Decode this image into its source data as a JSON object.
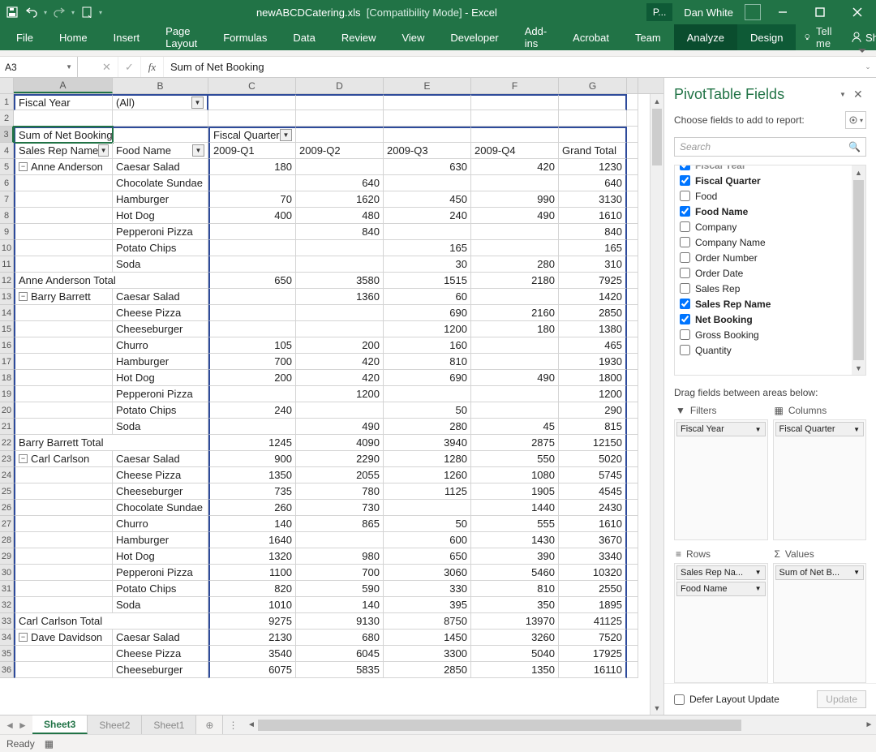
{
  "title": {
    "doc": "newABCDCatering.xls",
    "mode": "[Compatibility Mode]",
    "app": "Excel"
  },
  "account": {
    "context_letter": "P...",
    "user": "Dan White"
  },
  "ribbon": {
    "tabs": [
      "File",
      "Home",
      "Insert",
      "Page Layout",
      "Formulas",
      "Data",
      "Review",
      "View",
      "Developer",
      "Add-ins",
      "Acrobat",
      "Team",
      "Analyze",
      "Design"
    ],
    "tell_me": "Tell me",
    "share": "Share"
  },
  "namebox": "A3",
  "formula": "Sum of Net Booking",
  "columns": [
    "A",
    "B",
    "C",
    "D",
    "E",
    "F",
    "G"
  ],
  "pivot": {
    "page_field_label": "Fiscal Year",
    "page_field_value": "(All)",
    "data_field_label": "Sum of Net Booking",
    "col_field_label": "Fiscal Quarter",
    "row_field1_label": "Sales Rep Name",
    "row_field2_label": "Food Name",
    "col_headers": [
      "2009-Q1",
      "2009-Q2",
      "2009-Q3",
      "2009-Q4",
      "Grand Total"
    ]
  },
  "rows": [
    {
      "n": 5,
      "a": "Anne Anderson",
      "collapse": true,
      "b": "Caesar Salad",
      "c": "180",
      "d": "",
      "e": "630",
      "f": "420",
      "g": "1230"
    },
    {
      "n": 6,
      "a": "",
      "b": "Chocolate Sundae",
      "c": "",
      "d": "640",
      "e": "",
      "f": "",
      "g": "640"
    },
    {
      "n": 7,
      "a": "",
      "b": "Hamburger",
      "c": "70",
      "d": "1620",
      "e": "450",
      "f": "990",
      "g": "3130"
    },
    {
      "n": 8,
      "a": "",
      "b": "Hot Dog",
      "c": "400",
      "d": "480",
      "e": "240",
      "f": "490",
      "g": "1610"
    },
    {
      "n": 9,
      "a": "",
      "b": "Pepperoni Pizza",
      "c": "",
      "d": "840",
      "e": "",
      "f": "",
      "g": "840"
    },
    {
      "n": 10,
      "a": "",
      "b": "Potato Chips",
      "c": "",
      "d": "",
      "e": "165",
      "f": "",
      "g": "165"
    },
    {
      "n": 11,
      "a": "",
      "b": "Soda",
      "c": "",
      "d": "",
      "e": "30",
      "f": "280",
      "g": "310"
    },
    {
      "n": 12,
      "a": "Anne Anderson Total",
      "span": true,
      "c": "650",
      "d": "3580",
      "e": "1515",
      "f": "2180",
      "g": "7925"
    },
    {
      "n": 13,
      "a": "Barry Barrett",
      "collapse": true,
      "b": "Caesar Salad",
      "c": "",
      "d": "1360",
      "e": "60",
      "f": "",
      "g": "1420"
    },
    {
      "n": 14,
      "a": "",
      "b": "Cheese Pizza",
      "c": "",
      "d": "",
      "e": "690",
      "f": "2160",
      "g": "2850"
    },
    {
      "n": 15,
      "a": "",
      "b": "Cheeseburger",
      "c": "",
      "d": "",
      "e": "1200",
      "f": "180",
      "g": "1380"
    },
    {
      "n": 16,
      "a": "",
      "b": "Churro",
      "c": "105",
      "d": "200",
      "e": "160",
      "f": "",
      "g": "465"
    },
    {
      "n": 17,
      "a": "",
      "b": "Hamburger",
      "c": "700",
      "d": "420",
      "e": "810",
      "f": "",
      "g": "1930"
    },
    {
      "n": 18,
      "a": "",
      "b": "Hot Dog",
      "c": "200",
      "d": "420",
      "e": "690",
      "f": "490",
      "g": "1800"
    },
    {
      "n": 19,
      "a": "",
      "b": "Pepperoni Pizza",
      "c": "",
      "d": "1200",
      "e": "",
      "f": "",
      "g": "1200"
    },
    {
      "n": 20,
      "a": "",
      "b": "Potato Chips",
      "c": "240",
      "d": "",
      "e": "50",
      "f": "",
      "g": "290"
    },
    {
      "n": 21,
      "a": "",
      "b": "Soda",
      "c": "",
      "d": "490",
      "e": "280",
      "f": "45",
      "g": "815"
    },
    {
      "n": 22,
      "a": "Barry Barrett Total",
      "span": true,
      "c": "1245",
      "d": "4090",
      "e": "3940",
      "f": "2875",
      "g": "12150"
    },
    {
      "n": 23,
      "a": "Carl Carlson",
      "collapse": true,
      "b": "Caesar Salad",
      "c": "900",
      "d": "2290",
      "e": "1280",
      "f": "550",
      "g": "5020"
    },
    {
      "n": 24,
      "a": "",
      "b": "Cheese Pizza",
      "c": "1350",
      "d": "2055",
      "e": "1260",
      "f": "1080",
      "g": "5745"
    },
    {
      "n": 25,
      "a": "",
      "b": "Cheeseburger",
      "c": "735",
      "d": "780",
      "e": "1125",
      "f": "1905",
      "g": "4545"
    },
    {
      "n": 26,
      "a": "",
      "b": "Chocolate Sundae",
      "c": "260",
      "d": "730",
      "e": "",
      "f": "1440",
      "g": "2430"
    },
    {
      "n": 27,
      "a": "",
      "b": "Churro",
      "c": "140",
      "d": "865",
      "e": "50",
      "f": "555",
      "g": "1610"
    },
    {
      "n": 28,
      "a": "",
      "b": "Hamburger",
      "c": "1640",
      "d": "",
      "e": "600",
      "f": "1430",
      "g": "3670"
    },
    {
      "n": 29,
      "a": "",
      "b": "Hot Dog",
      "c": "1320",
      "d": "980",
      "e": "650",
      "f": "390",
      "g": "3340"
    },
    {
      "n": 30,
      "a": "",
      "b": "Pepperoni Pizza",
      "c": "1100",
      "d": "700",
      "e": "3060",
      "f": "5460",
      "g": "10320"
    },
    {
      "n": 31,
      "a": "",
      "b": "Potato Chips",
      "c": "820",
      "d": "590",
      "e": "330",
      "f": "810",
      "g": "2550"
    },
    {
      "n": 32,
      "a": "",
      "b": "Soda",
      "c": "1010",
      "d": "140",
      "e": "395",
      "f": "350",
      "g": "1895"
    },
    {
      "n": 33,
      "a": "Carl Carlson Total",
      "span": true,
      "c": "9275",
      "d": "9130",
      "e": "8750",
      "f": "13970",
      "g": "41125"
    },
    {
      "n": 34,
      "a": "Dave Davidson",
      "collapse": true,
      "b": "Caesar Salad",
      "c": "2130",
      "d": "680",
      "e": "1450",
      "f": "3260",
      "g": "7520"
    },
    {
      "n": 35,
      "a": "",
      "b": "Cheese Pizza",
      "c": "3540",
      "d": "6045",
      "e": "3300",
      "f": "5040",
      "g": "17925"
    },
    {
      "n": 36,
      "a": "",
      "b": "Cheeseburger",
      "c": "6075",
      "d": "5835",
      "e": "2850",
      "f": "1350",
      "g": "16110"
    }
  ],
  "pane": {
    "title": "PivotTable Fields",
    "subtitle": "Choose fields to add to report:",
    "search_placeholder": "Search",
    "fields": [
      {
        "label": "Fiscal Year",
        "checked": true,
        "cut": true
      },
      {
        "label": "Fiscal Quarter",
        "checked": true
      },
      {
        "label": "Food",
        "checked": false
      },
      {
        "label": "Food Name",
        "checked": true
      },
      {
        "label": "Company",
        "checked": false
      },
      {
        "label": "Company Name",
        "checked": false
      },
      {
        "label": "Order Number",
        "checked": false
      },
      {
        "label": "Order Date",
        "checked": false
      },
      {
        "label": "Sales Rep",
        "checked": false
      },
      {
        "label": "Sales Rep Name",
        "checked": true
      },
      {
        "label": "Net Booking",
        "checked": true
      },
      {
        "label": "Gross Booking",
        "checked": false
      },
      {
        "label": "Quantity",
        "checked": false
      }
    ],
    "areas_caption": "Drag fields between areas below:",
    "area_filters": "Filters",
    "area_columns": "Columns",
    "area_rows": "Rows",
    "area_values": "Values",
    "filter_pills": [
      "Fiscal Year"
    ],
    "column_pills": [
      "Fiscal Quarter"
    ],
    "row_pills": [
      "Sales Rep Na...",
      "Food Name"
    ],
    "value_pills": [
      "Sum of Net B..."
    ],
    "defer_label": "Defer Layout Update",
    "update_label": "Update"
  },
  "sheets": {
    "active": "Sheet3",
    "others": [
      "Sheet2",
      "Sheet1"
    ]
  },
  "status": "Ready"
}
